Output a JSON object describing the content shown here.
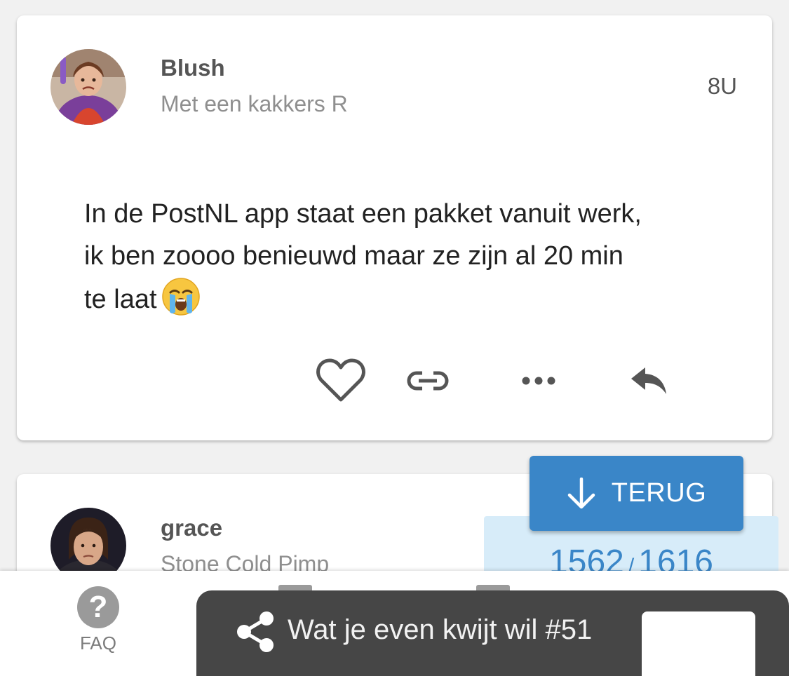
{
  "post1": {
    "username": "Blush",
    "usertitle": "Met een kakkers R",
    "time": "8U",
    "body_line1": "In de PostNL app staat een pakket vanuit werk,",
    "body_line2": "ik ben zoooo benieuwd maar ze zijn al 20 min",
    "body_line3": "te laat",
    "emoji": "loudly-crying-face",
    "actions": [
      "heart-icon",
      "link-icon",
      "more-icon",
      "reply-icon"
    ]
  },
  "post2": {
    "username": "grace",
    "usertitle": "Stone Cold Pimp"
  },
  "terug": {
    "label": "TERUG",
    "icon": "arrow-down-icon"
  },
  "progress": {
    "current": "1562",
    "separator": "/",
    "total": "1616"
  },
  "bottom_nav": {
    "faq_label": "FAQ",
    "faq_icon": "question-icon"
  },
  "toast": {
    "text": "Wat je even kwijt wil #51",
    "icon": "share-icon"
  },
  "colors": {
    "accent": "#3a86c8",
    "progress_bg": "#d7ecf9",
    "toast_bg": "#464646"
  }
}
